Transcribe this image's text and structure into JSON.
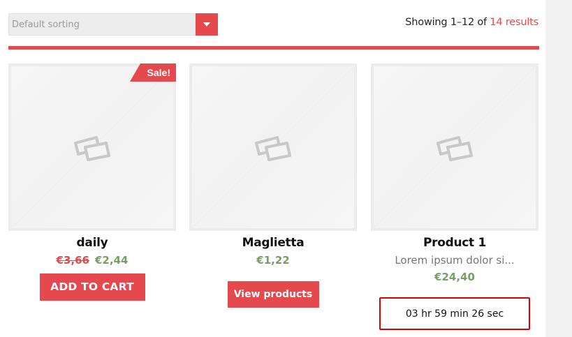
{
  "toolbar": {
    "sort_selected": "Default sorting",
    "results_prefix": "Showing 1–12 of ",
    "results_total": "14 results"
  },
  "products": [
    {
      "name": "daily",
      "badge": "Sale!",
      "price_old": "€3,66",
      "price": "€2,44",
      "button": "ADD TO CART"
    },
    {
      "name": "Maglietta",
      "price": "€1,22",
      "button": "View products"
    },
    {
      "name": "Product 1",
      "excerpt": "Lorem ipsum dolor si...",
      "price": "€24,40",
      "countdown": "03 hr 59 min 26 sec"
    }
  ],
  "colors": {
    "accent": "#e5484d",
    "price_green": "#7a9d68",
    "countdown_border": "#d80000"
  },
  "icons": {
    "sort_arrow": "caret-down-icon",
    "placeholder": "image-placeholder-icon"
  }
}
